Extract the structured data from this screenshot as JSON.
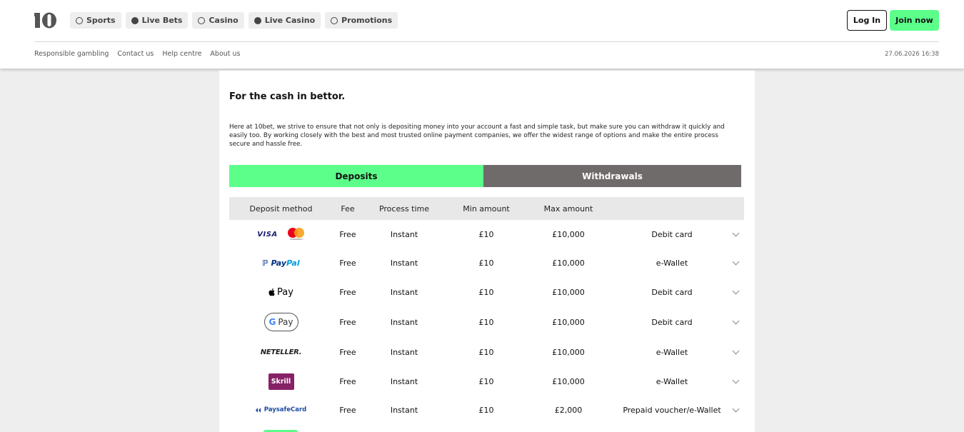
{
  "header": {
    "logo_alt": "10",
    "nav": [
      {
        "label": "Sports",
        "icon": "soccer-ball-icon"
      },
      {
        "label": "Live Bets",
        "icon": "live-icon"
      },
      {
        "label": "Casino",
        "icon": "casino-chip-icon"
      },
      {
        "label": "Live Casino",
        "icon": "roulette-icon"
      },
      {
        "label": "Promotions",
        "icon": "gift-icon"
      }
    ],
    "login_label": "Log In",
    "join_label": "Join now",
    "sublinks": [
      "Responsible gambling",
      "Contact us",
      "Help centre",
      "About us"
    ],
    "datetime": "27.06.2026 16:38"
  },
  "content": {
    "title": "For the cash in bettor.",
    "intro": "Here at 10bet, we strive to ensure that not only is depositing money into your account a fast and simple task, but make sure you can withdraw it quickly and easily too. By working closely with the best and most trusted online payment companies, we offer the widest range of options and make the entire process secure and hassle free.",
    "tabs": {
      "deposits": "Deposits",
      "withdrawals": "Withdrawals"
    },
    "columns": {
      "method": "Deposit method",
      "fee": "Fee",
      "time": "Process time",
      "min": "Min amount",
      "max": "Max amount"
    },
    "rows": [
      {
        "method": "VISA / Mastercard",
        "fee": "Free",
        "time": "Instant",
        "min": "£10",
        "max": "£10,000",
        "type": "Debit card"
      },
      {
        "method": "PayPal",
        "fee": "Free",
        "time": "Instant",
        "min": "£10",
        "max": "£10,000",
        "type": "e-Wallet"
      },
      {
        "method": "Apple Pay",
        "fee": "Free",
        "time": "Instant",
        "min": "£10",
        "max": "£10,000",
        "type": "Debit card"
      },
      {
        "method": "Google Pay",
        "fee": "Free",
        "time": "Instant",
        "min": "£10",
        "max": "£10,000",
        "type": "Debit card"
      },
      {
        "method": "NETELLER",
        "fee": "Free",
        "time": "Instant",
        "min": "£10",
        "max": "£10,000",
        "type": "e-Wallet"
      },
      {
        "method": "Skrill",
        "fee": "Free",
        "time": "Instant",
        "min": "£10",
        "max": "£10,000",
        "type": "e-Wallet"
      },
      {
        "method": "PaysafeCard",
        "fee": "Free",
        "time": "Instant",
        "min": "£10",
        "max": "£2,000",
        "type": "Prepaid voucher/e-Wallet"
      }
    ],
    "logos": {
      "visa": "VISA",
      "paypal_1": "Pay",
      "paypal_2": "Pal",
      "applepay": "Pay",
      "gpay_g": "G",
      "gpay_pay": "Pay",
      "neteller": "NETELLER.",
      "skrill": "Skrill",
      "paysafe": "PaysafeCard"
    }
  },
  "colors": {
    "accent": "#5cff8a",
    "withdrawals_tab": "#706b6b",
    "background": "#eeeeee",
    "skrill": "#862165"
  }
}
